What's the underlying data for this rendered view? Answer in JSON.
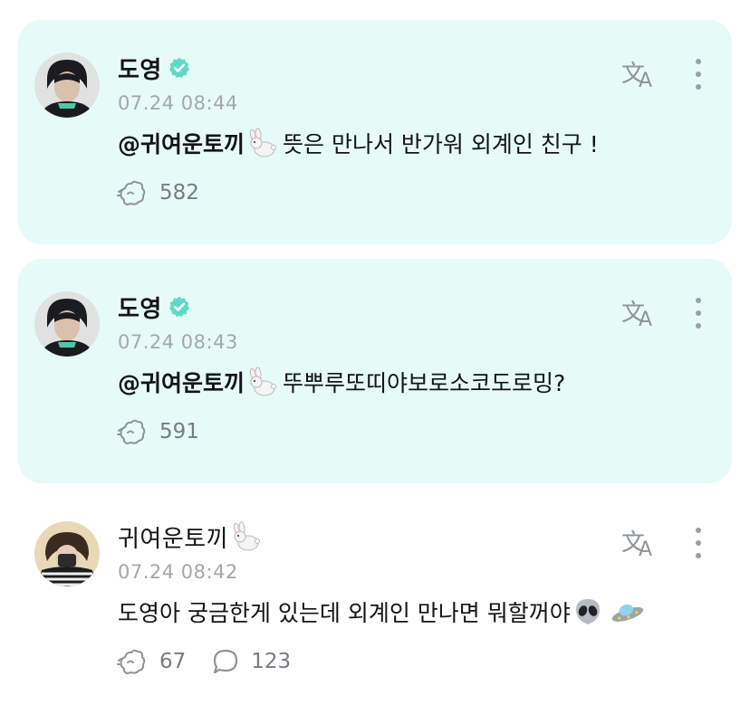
{
  "colors": {
    "card_highlight": "#e6faf7",
    "verified": "#5fd8c8",
    "muted": "#a3a7ad",
    "icon": "#8e9399"
  },
  "icons": {
    "verified": "verified-badge-icon",
    "translate": "translate-icon",
    "more": "more-vertical-icon",
    "like": "rabbit-paw-like-icon",
    "reply": "speech-bubble-icon",
    "rabbit": "rabbit-emoji",
    "alien": "alien-emoji",
    "ufo": "flying-saucer-emoji"
  },
  "posts": [
    {
      "author": "도영",
      "verified": true,
      "timestamp": "07.24 08:44",
      "mention": "@귀여운토끼",
      "text": "뜻은 만나서 반가워 외계인 친구 !",
      "likes": "582"
    },
    {
      "author": "도영",
      "verified": true,
      "timestamp": "07.24 08:43",
      "mention": "@귀여운토끼",
      "text": "뚜뿌루또띠야보로소코도로밍?",
      "likes": "591"
    },
    {
      "author": "귀여운토끼",
      "verified": false,
      "timestamp": "07.24 08:42",
      "text": "도영아 궁금한게 있는데 외계인 만나면 뭐할꺼야",
      "likes": "67",
      "replies": "123"
    }
  ]
}
